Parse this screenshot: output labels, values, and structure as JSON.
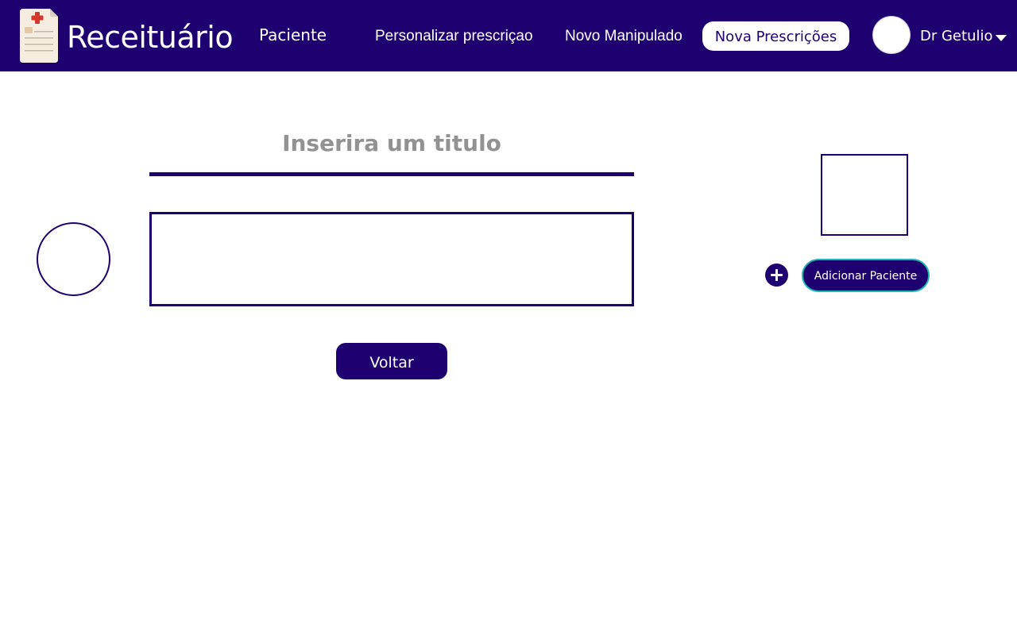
{
  "app": {
    "title": "Receituário",
    "logo_icon": "prescription-document-icon"
  },
  "nav": {
    "items": [
      {
        "label": "Paciente"
      },
      {
        "label": "Personalizar prescriçao"
      },
      {
        "label": "Novo Manipulado"
      }
    ],
    "primary_button": "Nova Prescrições"
  },
  "user": {
    "name": "Dr Getulio",
    "menu_icon": "caret-down-icon"
  },
  "form": {
    "title_placeholder": "Inserira um titulo",
    "back_button": "Voltar"
  },
  "side_panel": {
    "add_icon": "plus-icon",
    "add_patient_button": "Adicionar Paciente"
  },
  "colors": {
    "primary": "#1f0070",
    "accent_border": "#1fb5b0",
    "placeholder": "#929292",
    "background": "#ffffff"
  }
}
